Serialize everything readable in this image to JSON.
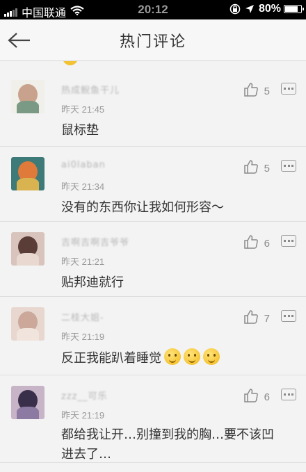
{
  "status_bar": {
    "carrier": "中国联通",
    "time": "20:12",
    "battery": "80%",
    "battery_level": 0.8
  },
  "nav": {
    "title": "热门评论"
  },
  "comments": [
    {
      "username": "热成鲵鱼干儿",
      "time": "昨天 21:45",
      "text": "鼠标垫",
      "likes": "5",
      "avatar_colors": [
        "#f1efe9",
        "#c8a28c",
        "#7b9a85"
      ]
    },
    {
      "username": "ai0laban",
      "time": "昨天 21:34",
      "text": "没有的东西你让我如何形容～",
      "likes": "5",
      "avatar_colors": [
        "#3d7a78",
        "#e07a3a",
        "#d8b350"
      ]
    },
    {
      "username": "吉啊吉啊吉爷爷",
      "time": "昨天 21:21",
      "text": "贴邦迪就行",
      "likes": "6",
      "avatar_colors": [
        "#d8c4bc",
        "#5a3d36",
        "#e8d8d0"
      ]
    },
    {
      "username": "二桂大姐-",
      "time": "昨天 21:19",
      "text": "反正我能趴着睡觉",
      "likes": "7",
      "avatar_colors": [
        "#e7d7cf",
        "#cba89a",
        "#f1e4dd"
      ]
    },
    {
      "username": "zzz__可乐",
      "time": "昨天 21:19",
      "text": "都给我让开…别撞到我的胸…要不该凹进去了…",
      "likes": "6",
      "avatar_colors": [
        "#c7b4c7",
        "#3a2f4a",
        "#8c7aa2"
      ]
    }
  ]
}
